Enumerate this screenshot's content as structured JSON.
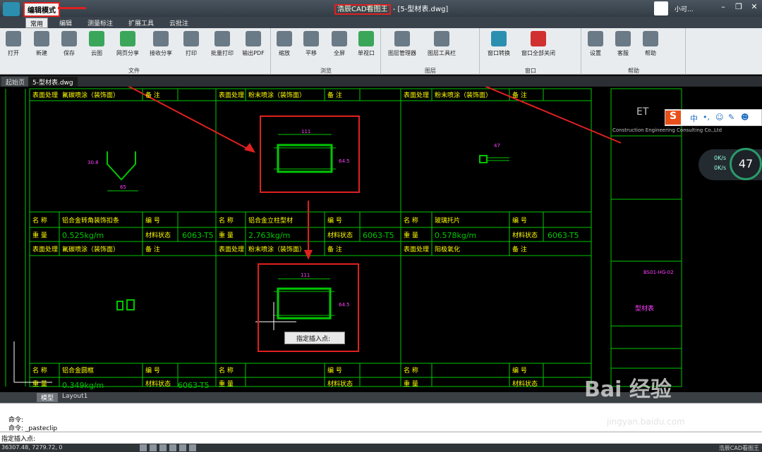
{
  "titlebar": {
    "mode_label": "编辑模式",
    "app_name": "浩辰CAD看图王",
    "file_suffix": " - [5-型材表.dwg]",
    "user_name": "小可...",
    "min": "–",
    "max": "❐",
    "close": "✕"
  },
  "ribbon_tabs": [
    "常用",
    "编辑",
    "测量标注",
    "扩展工具",
    "云批注"
  ],
  "ribbon_buttons": [
    {
      "label": "打开",
      "icon": "folder-open-icon"
    },
    {
      "label": "新建",
      "icon": "new-file-icon"
    },
    {
      "label": "保存",
      "icon": "save-icon"
    },
    {
      "label": "云图",
      "icon": "cloud-icon"
    },
    {
      "label": "网页分享",
      "icon": "share-icon"
    },
    {
      "label": "接收分享",
      "icon": "receive-icon"
    },
    {
      "label": "打印",
      "icon": "print-icon"
    },
    {
      "label": "批量打印",
      "icon": "batch-print-icon"
    },
    {
      "label": "输出PDF",
      "icon": "pdf-icon"
    },
    {
      "label": "缩放",
      "icon": "zoom-icon"
    },
    {
      "label": "平移",
      "icon": "pan-icon"
    },
    {
      "label": "全屏",
      "icon": "fullscreen-icon"
    },
    {
      "label": "单视口",
      "icon": "single-viewport-icon"
    },
    {
      "label": "图层管理器",
      "icon": "layers-icon"
    },
    {
      "label": "图层工具栏",
      "icon": "layer-toolbar-icon"
    },
    {
      "label": "窗口转换",
      "icon": "window-switch-icon"
    },
    {
      "label": "窗口全部关闭",
      "icon": "close-all-icon"
    },
    {
      "label": "设置",
      "icon": "settings-icon"
    },
    {
      "label": "客服",
      "icon": "headset-icon"
    },
    {
      "label": "帮助",
      "icon": "help-icon"
    }
  ],
  "ribbon_groups": [
    "文件",
    "浏览",
    "图层",
    "窗口",
    "帮助"
  ],
  "doc_tabs": [
    "起始页",
    "5-型材表.dwg"
  ],
  "drawing": {
    "surface": "表面处理",
    "remark": "备 注",
    "name": "名 称",
    "number": "编 号",
    "weight": "重 量",
    "material": "材料状态",
    "alloy": "6063-T5",
    "row1": {
      "c1": "氟碳喷涂（装饰面）",
      "c2": "粉末喷涂（装饰面）",
      "c3": "粉末喷涂（装饰面）"
    },
    "row2": {
      "n1": "铝合金转角装饰扣条",
      "w1": "0.525kg/m",
      "n2": "铝合金立柱型材",
      "w2": "2.763kg/m",
      "n3": "玻璃托片",
      "w3": "0.578kg/m"
    },
    "row3": {
      "c1": "氟碳喷涂（装饰面）",
      "c2": "粉末喷涂（装饰面）",
      "c3": "阳极氧化"
    },
    "row4": {
      "n1": "铝合金圆框",
      "w1": "0.349kg/m",
      "a1": "6063-T5"
    },
    "dim_top": "111",
    "dim_side": "64.5",
    "dim_left": "30.8",
    "dim_bot": "65",
    "dim_right": "47",
    "title_block": "型材表",
    "company_en": "Construction Engineering Consulting Co.,Ltd",
    "drawing_no": "BS01-HG-02",
    "et_logo": "ET"
  },
  "insert_prompt": "指定插入点:",
  "ime": {
    "lang": "中",
    "punct": "•,"
  },
  "net": {
    "up": "0K/s",
    "down": "0K/s",
    "percent": "47"
  },
  "layout_tabs": [
    "模型",
    "Layout1"
  ],
  "command": {
    "line1": "命令:",
    "line2": "命令: _pasteclip",
    "prompt": "指定插入点:"
  },
  "status": {
    "coords": "36307.48, 7279.72, 0",
    "app": "浩辰CAD看图王"
  },
  "watermark": {
    "brand": "Bai 经验",
    "url": "jingyan.baidu.com"
  },
  "colors": {
    "cad_green": "#00c800",
    "cad_yellow": "#ffff00",
    "highlight_red": "#e02020",
    "ui_dark": "#333c45"
  }
}
